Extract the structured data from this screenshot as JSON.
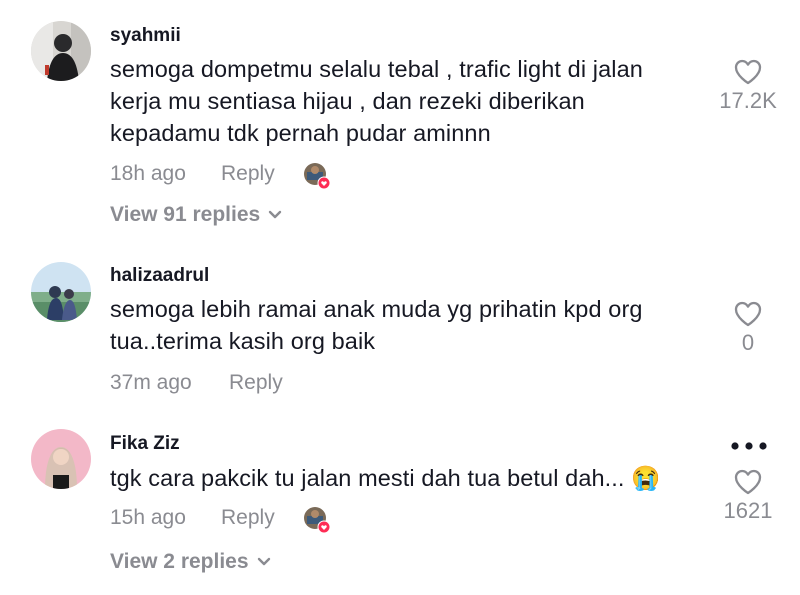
{
  "colors": {
    "text": "#161823",
    "secondary": "#8a8b91",
    "liked_badge": "#fe2c55"
  },
  "comments": [
    {
      "username": "syahmii",
      "lines": [
        "semoga dompetmu selalu tebal , trafic light di jalan",
        "kerja mu sentiasa hijau , dan rezeki diberikan",
        "kepadamu tdk pernah pudar aminnn"
      ],
      "time": "18h ago",
      "reply_label": "Reply",
      "like_count": "17.2K",
      "view_replies": "View 91 replies",
      "creator_liked": true
    },
    {
      "username": "halizaadrul",
      "lines": [
        "semoga lebih ramai anak muda yg prihatin kpd org",
        "tua..terima kasih org baik"
      ],
      "time": "37m ago",
      "reply_label": "Reply",
      "like_count": "0",
      "creator_liked": false
    },
    {
      "username": "Fika Ziz",
      "lines": [
        "tgk cara pakcik tu jalan mesti dah tua betul dah... 😭"
      ],
      "time": "15h ago",
      "reply_label": "Reply",
      "like_count": "1621",
      "view_replies": "View 2 replies",
      "creator_liked": true
    }
  ],
  "icons": {
    "like": "heart-outline-icon",
    "more": "more-horizontal-icon",
    "chevron": "chevron-down-icon",
    "creator_liked": "creator-liked-badge-icon"
  }
}
